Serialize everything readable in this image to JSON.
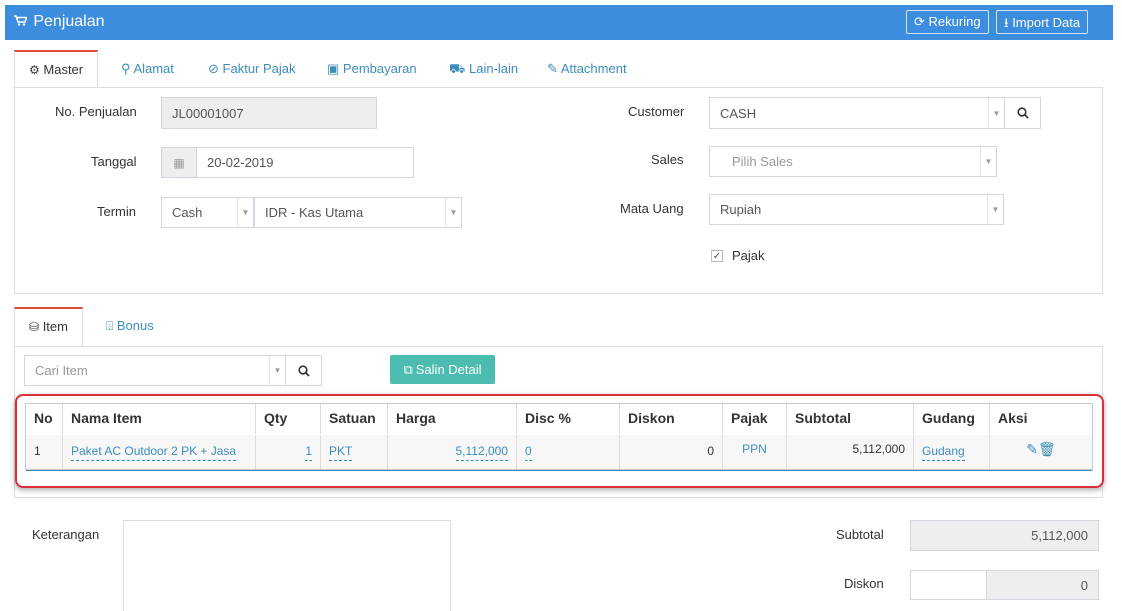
{
  "header": {
    "title": "Penjualan",
    "rekuring_label": "Rekuring",
    "import_label": "Import Data"
  },
  "tabs": [
    {
      "label": "Master"
    },
    {
      "label": "Alamat"
    },
    {
      "label": "Faktur Pajak"
    },
    {
      "label": "Pembayaran"
    },
    {
      "label": "Lain-lain"
    },
    {
      "label": "Attachment"
    }
  ],
  "form": {
    "no_penjualan_label": "No. Penjualan",
    "no_penjualan_value": "JL00001007",
    "tanggal_label": "Tanggal",
    "tanggal_value": "20-02-2019",
    "termin_label": "Termin",
    "termin_value": "Cash",
    "kas_value": "IDR - Kas Utama",
    "customer_label": "Customer",
    "customer_value": "CASH",
    "sales_label": "Sales",
    "sales_placeholder": "Pilih Sales",
    "mata_uang_label": "Mata Uang",
    "mata_uang_value": "Rupiah",
    "pajak_label": "Pajak",
    "pajak_checked": true
  },
  "item_tabs": [
    {
      "label": "Item"
    },
    {
      "label": "Bonus"
    }
  ],
  "item_search": {
    "placeholder": "Cari Item",
    "salin_label": "Salin Detail"
  },
  "table": {
    "columns": [
      "No",
      "Nama Item",
      "Qty",
      "Satuan",
      "Harga",
      "Disc %",
      "Diskon",
      "Pajak",
      "Subtotal",
      "Gudang",
      "Aksi"
    ],
    "rows": [
      {
        "no": "1",
        "nama_item": "Paket AC Outdoor 2 PK + Jasa",
        "qty": "1",
        "satuan": "PKT",
        "harga": "5,112,000",
        "disc": "0",
        "diskon": "0",
        "pajak": "PPN",
        "subtotal": "5,112,000",
        "gudang": "Gudang"
      }
    ]
  },
  "footer": {
    "keterangan_label": "Keterangan",
    "subtotal_label": "Subtotal",
    "subtotal_value": "5,112,000",
    "diskon_label": "Diskon",
    "diskon_value": "0"
  },
  "colors": {
    "header_bg": "#3c8dde",
    "salin_button": "#4cbcb1",
    "highlight": "#d9303a",
    "link": "#3c8dbc"
  }
}
